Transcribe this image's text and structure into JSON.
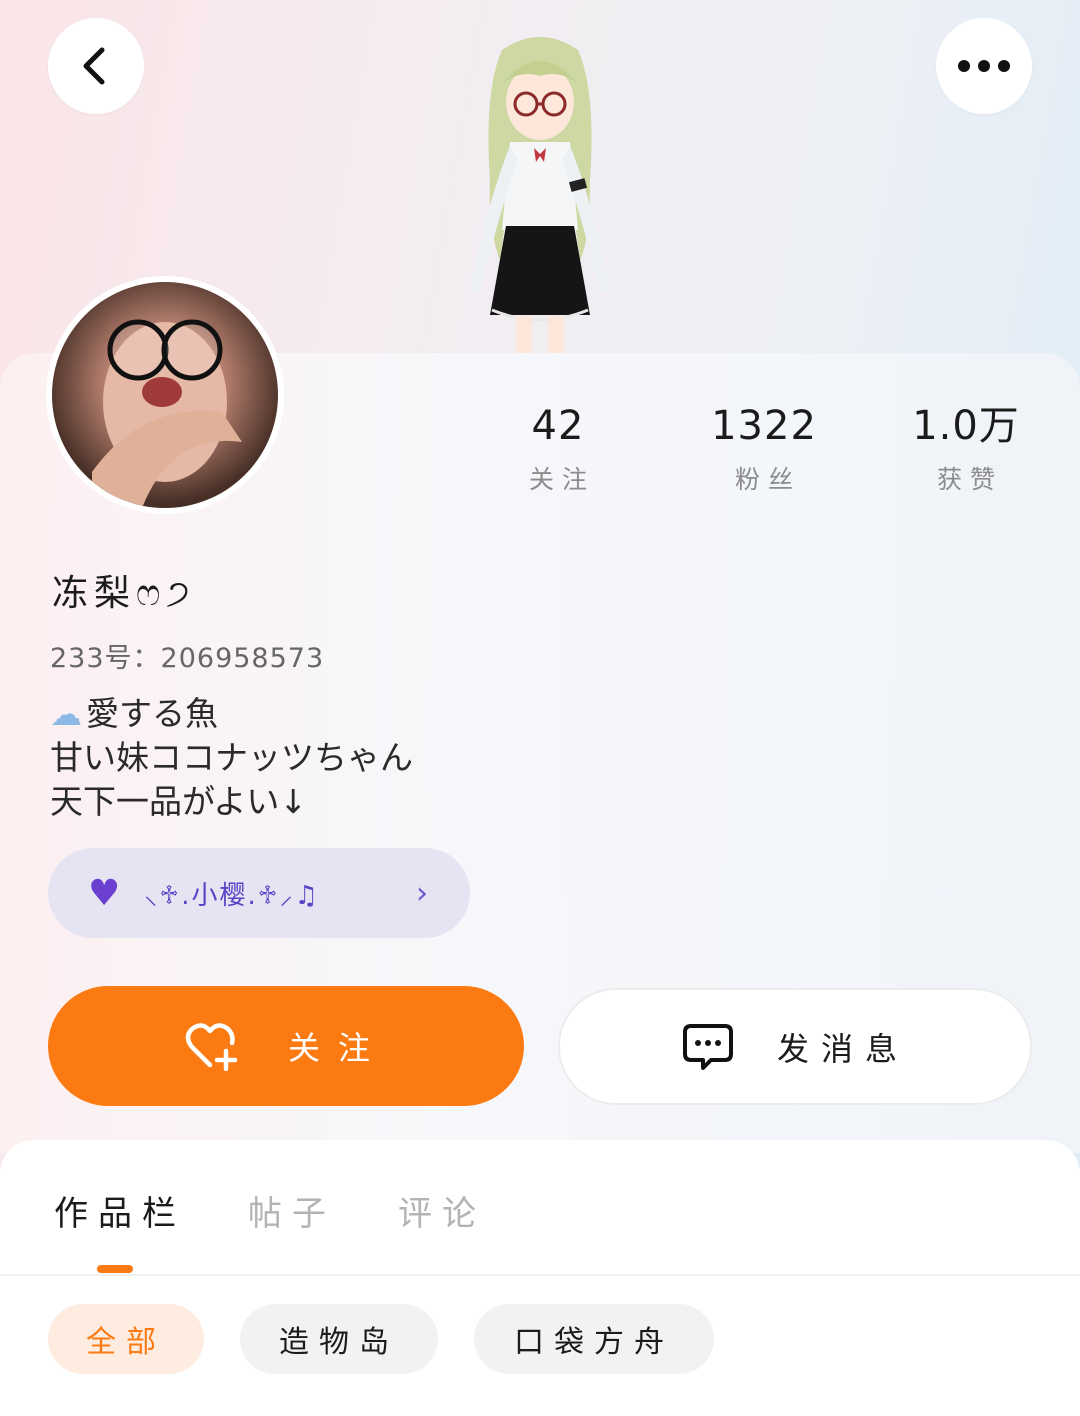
{
  "header": {
    "back_icon": "chevron-left-icon",
    "more_icon": "more-dots-icon"
  },
  "stats": [
    {
      "value": "42",
      "label": "关注"
    },
    {
      "value": "1322",
      "label": "粉丝"
    },
    {
      "value": "1.0万",
      "label": "获赞"
    }
  ],
  "profile": {
    "nickname": "冻梨ෆ੭",
    "uid": "233号：206958573",
    "bio": [
      "愛する魚",
      "甘い妹ココナッツちゃん",
      "天下一品がよい↓"
    ]
  },
  "fan_badge": {
    "name": "⸜♱.小樱.♱⸝♫",
    "icon": "heart-icon",
    "color": "#5a43c6"
  },
  "actions": {
    "follow_label": "关注",
    "message_label": "发消息"
  },
  "tabs": [
    {
      "label": "作品栏",
      "active": true
    },
    {
      "label": "帖子",
      "active": false
    },
    {
      "label": "评论",
      "active": false
    }
  ],
  "filters": [
    {
      "label": "全部",
      "active": true
    },
    {
      "label": "造物岛",
      "active": false
    },
    {
      "label": "口袋方舟",
      "active": false
    }
  ],
  "colors": {
    "accent": "#fb7a12",
    "fan_pill_bg": "#e6e3f3"
  }
}
